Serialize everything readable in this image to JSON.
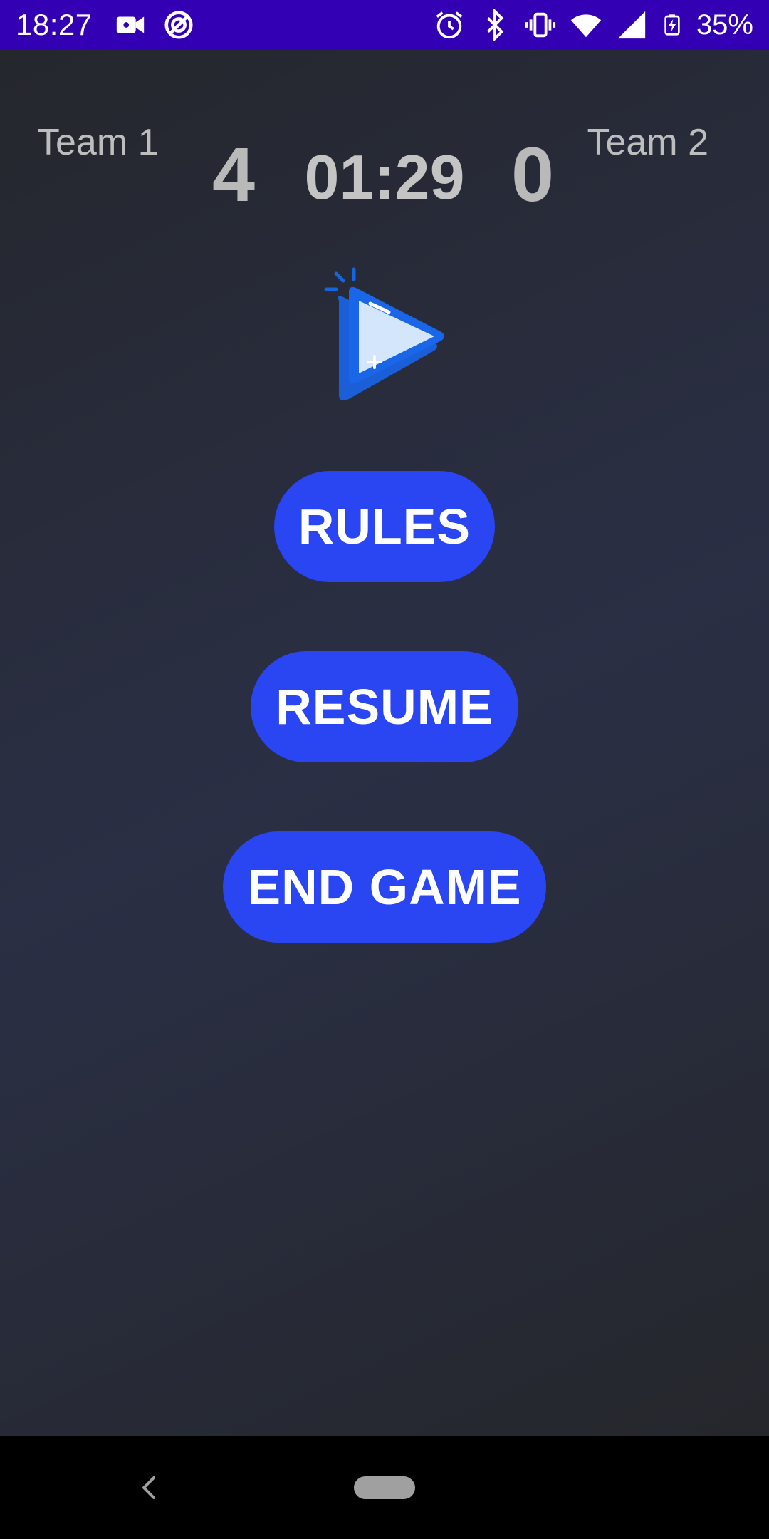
{
  "status_bar": {
    "time": "18:27",
    "battery": "35%",
    "left_icons": [
      "video-camera-icon",
      "sync-indicator-icon"
    ],
    "right_icons": [
      "alarm-icon",
      "bluetooth-icon",
      "vibrate-icon",
      "wifi-icon",
      "signal-icon",
      "battery-charging-icon"
    ],
    "background": "#3400b4"
  },
  "scoreboard": {
    "team1_name": "Team 1",
    "team2_name": "Team 2",
    "team1_score": "4",
    "team2_score": "0",
    "timer": "01:29"
  },
  "logo": {
    "icon": "play-triangle-logo-icon",
    "accent": "#1565e0"
  },
  "menu": {
    "rules_label": "RULES",
    "resume_label": "RESUME",
    "end_game_label": "END GAME",
    "button_color": "#2a45f2"
  },
  "nav_bar": {
    "back_icon": "back-chevron-icon",
    "home_icon": "home-pill-icon"
  }
}
